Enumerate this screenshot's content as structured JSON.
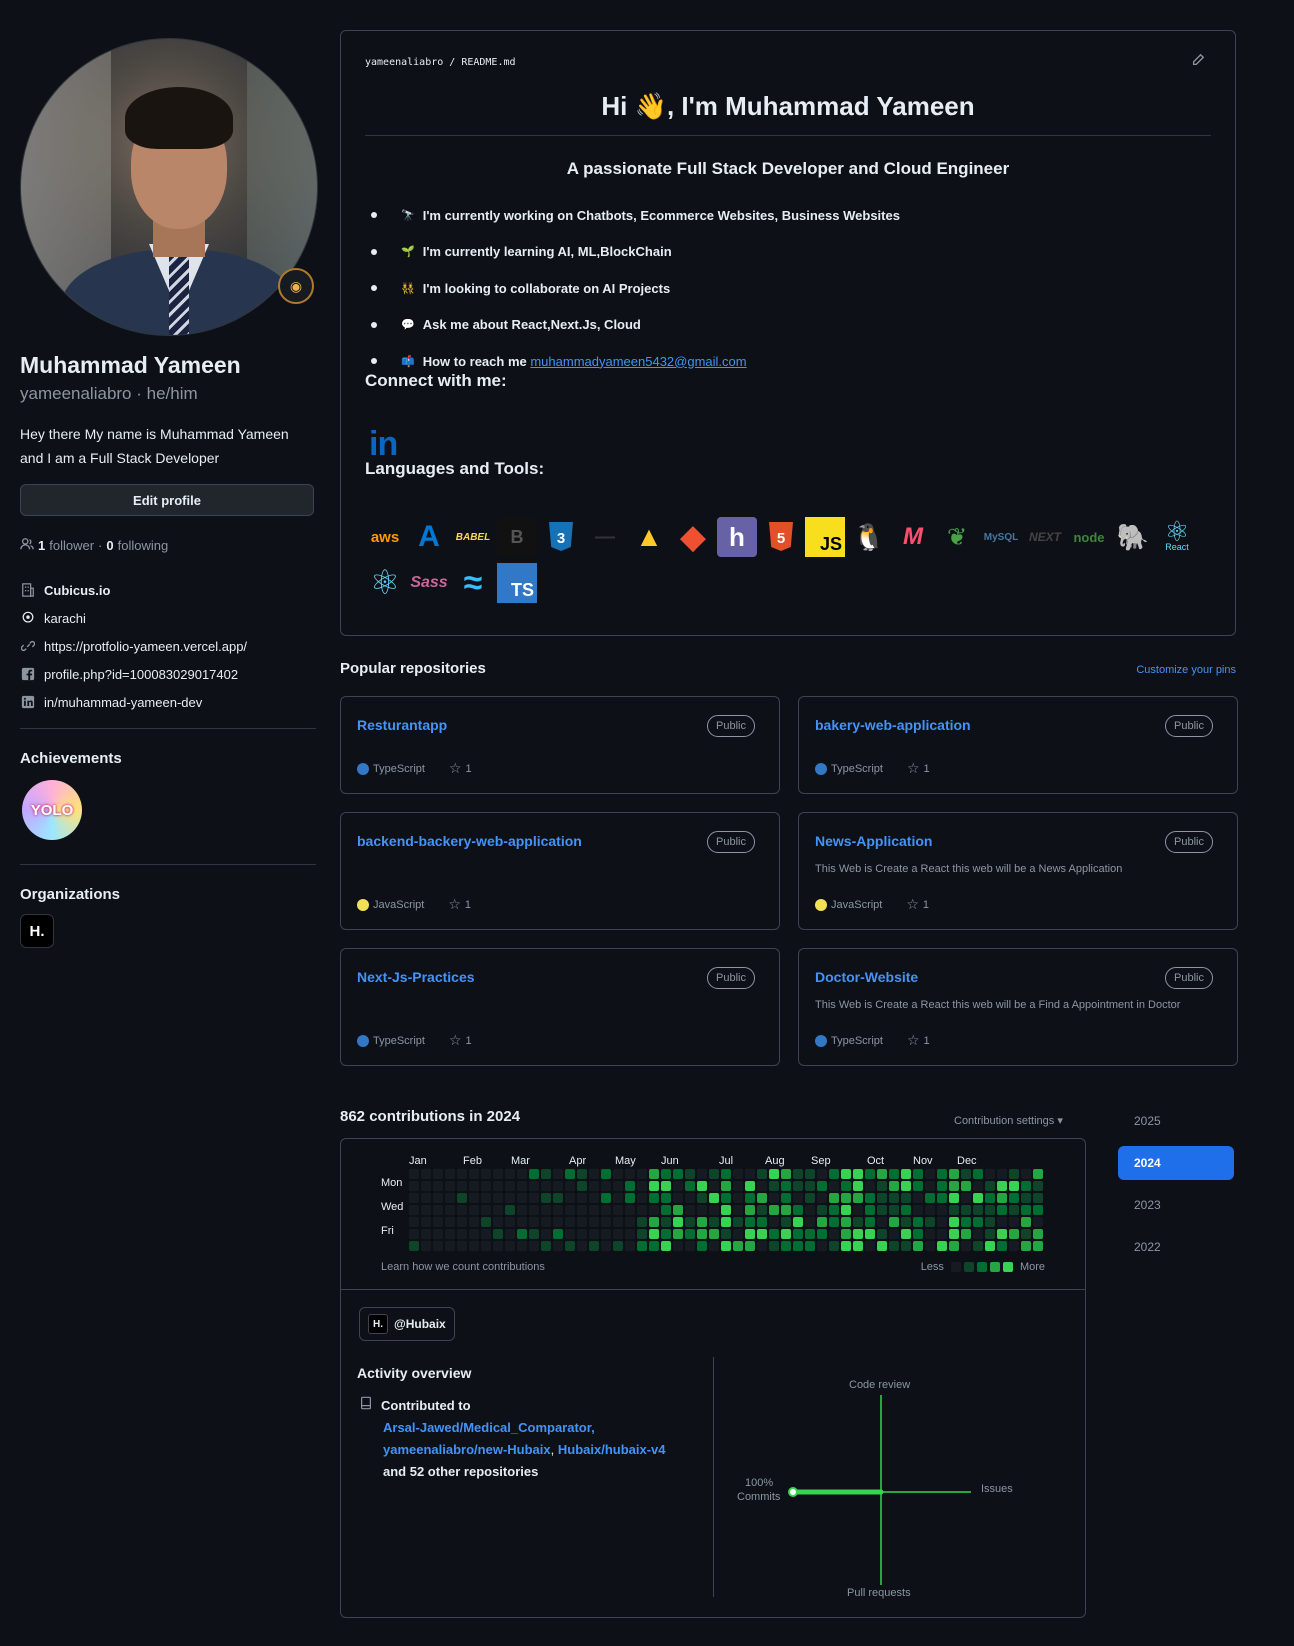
{
  "profile": {
    "name": "Muhammad Yameen",
    "login_line": "yameenaliabro · he/him",
    "bio": "Hey there My name is Muhammad Yameen and I am a Full Stack Developer",
    "edit_label": "Edit profile",
    "followers": "1",
    "followers_label": "follower",
    "following": "0",
    "following_label": "following",
    "info": [
      {
        "icon": "building-icon",
        "text": "Cubicus.io"
      },
      {
        "icon": "location-icon",
        "text": "karachi"
      },
      {
        "icon": "link-icon",
        "text": "https://protfolio-yameen.vercel.app/"
      },
      {
        "icon": "facebook-icon",
        "text": "profile.php?id=100083029017402"
      },
      {
        "icon": "linkedin-icon",
        "text": "in/muhammad-yameen-dev"
      }
    ],
    "achievements_title": "Achievements",
    "achievement_badge": "YOLO",
    "organizations_title": "Organizations",
    "org_logo": "H."
  },
  "readme": {
    "path": "yameenaliabro / README.md",
    "heading": "Hi 👋, I'm Muhammad Yameen",
    "subheading": "A passionate Full Stack Developer and Cloud Engineer",
    "items": [
      {
        "emoji": "🔭",
        "text": "I'm currently working on Chatbots, Ecommerce Websites, Business Websites"
      },
      {
        "emoji": "🌱",
        "text": "I'm currently learning AI, ML,BlockChain"
      },
      {
        "emoji": "👯",
        "text": "I'm looking to collaborate on AI Projects"
      },
      {
        "emoji": "💬",
        "text": "Ask me about React,Next.Js, Cloud"
      },
      {
        "emoji": "📫",
        "text": "How to reach me ",
        "link": "muhammadyameen5432@gmail.com"
      }
    ],
    "connect_title": "Connect with me:",
    "linkedin_glyph": "in",
    "tools_title": "Languages and Tools:",
    "tools": [
      {
        "name": "aws-icon",
        "label": "aws",
        "color": "#ff9900"
      },
      {
        "name": "azure-icon",
        "label": "A",
        "color": "#0078d4"
      },
      {
        "name": "babel-icon",
        "label": "BABEL",
        "color": "#f5da55"
      },
      {
        "name": "bootstrap-icon",
        "label": "B",
        "color": "#111111"
      },
      {
        "name": "css3-icon",
        "label": "3",
        "color": "#1572b6"
      },
      {
        "name": "express-icon",
        "label": "—",
        "color": "#333333"
      },
      {
        "name": "firebase-icon",
        "label": "▲",
        "color": "#ffca28"
      },
      {
        "name": "git-icon",
        "label": "◆",
        "color": "#f05032"
      },
      {
        "name": "heroku-icon",
        "label": "h",
        "color": "#6762a6"
      },
      {
        "name": "html5-icon",
        "label": "5",
        "color": "#e34f26"
      },
      {
        "name": "javascript-icon",
        "label": "JS",
        "color": "#f7df1e"
      },
      {
        "name": "linux-icon",
        "label": "🐧",
        "color": "#222222"
      },
      {
        "name": "mongoose-icon",
        "label": "M",
        "color": "#ff4f6e"
      },
      {
        "name": "mongodb-icon",
        "label": "❦",
        "color": "#47a248"
      },
      {
        "name": "mysql-icon",
        "label": "MySQL",
        "color": "#4479a1"
      },
      {
        "name": "nextjs-icon",
        "label": "NEXT",
        "color": "#444444"
      },
      {
        "name": "nodejs-icon",
        "label": "node",
        "color": "#3c873a"
      },
      {
        "name": "postgresql-icon",
        "label": "🐘",
        "color": "#336791"
      },
      {
        "name": "react-native-icon",
        "label": "⚛",
        "color": "#61dafb"
      },
      {
        "name": "react-icon",
        "label": "⚛",
        "color": "#61dafb"
      },
      {
        "name": "sass-icon",
        "label": "Sass",
        "color": "#cc6699"
      },
      {
        "name": "tailwind-icon",
        "label": "≈",
        "color": "#38bdf8"
      },
      {
        "name": "typescript-icon",
        "label": "TS",
        "color": "#3178c6"
      }
    ],
    "react_caption": "React"
  },
  "popular": {
    "title": "Popular repositories",
    "customize": "Customize your pins",
    "repos": [
      {
        "name": "Resturantapp",
        "badge": "Public",
        "desc": "",
        "lang": "TypeScript",
        "lang_color": "#3178c6",
        "stars": "1"
      },
      {
        "name": "bakery-web-application",
        "badge": "Public",
        "desc": "",
        "lang": "TypeScript",
        "lang_color": "#3178c6",
        "stars": "1"
      },
      {
        "name": "backend-backery-web-application",
        "badge": "Public",
        "desc": "",
        "lang": "JavaScript",
        "lang_color": "#f1e05a",
        "stars": "1"
      },
      {
        "name": "News-Application",
        "badge": "Public",
        "desc": "This Web is Create a React this web will be a News Application",
        "lang": "JavaScript",
        "lang_color": "#f1e05a",
        "stars": "1"
      },
      {
        "name": "Next-Js-Practices",
        "badge": "Public",
        "desc": "",
        "lang": "TypeScript",
        "lang_color": "#3178c6",
        "stars": "1"
      },
      {
        "name": "Doctor-Website",
        "badge": "Public",
        "desc": "This Web is Create a React this web will be a Find a Appointment in Doctor",
        "lang": "TypeScript",
        "lang_color": "#3178c6",
        "stars": "1"
      }
    ]
  },
  "contributions": {
    "title": "862 contributions in 2024",
    "settings": "Contribution settings ▾",
    "months": [
      "Jan",
      "Feb",
      "Mar",
      "Apr",
      "May",
      "Jun",
      "Jul",
      "Aug",
      "Sep",
      "Oct",
      "Nov",
      "Dec"
    ],
    "days": [
      "Mon",
      "Wed",
      "Fri"
    ],
    "learn": "Learn how we count contributions",
    "legend_less": "Less",
    "legend_more": "More",
    "legend_colors": [
      "#161b22",
      "#0e4429",
      "#006d32",
      "#26a641",
      "#39d353"
    ],
    "years": [
      "2025",
      "2024",
      "2023",
      "2022"
    ],
    "active_year": "2024",
    "org_chip": "@Hubaix",
    "org_chip_logo": "H.",
    "activity_title": "Activity overview",
    "contributed_to": "Contributed to",
    "repos_line1": "Arsal-Jawed/Medical_Comparator,",
    "repo_link2": "yameenaliabro/new-Hubaix",
    "repo_link3": "Hubaix/hubaix-v4",
    "repos_more": "and 52 other repositories",
    "axis": {
      "top": "Code review",
      "right": "Issues",
      "bottom": "Pull requests",
      "left_pct": "100%",
      "left": "Commits"
    },
    "commits_pct": 100
  }
}
